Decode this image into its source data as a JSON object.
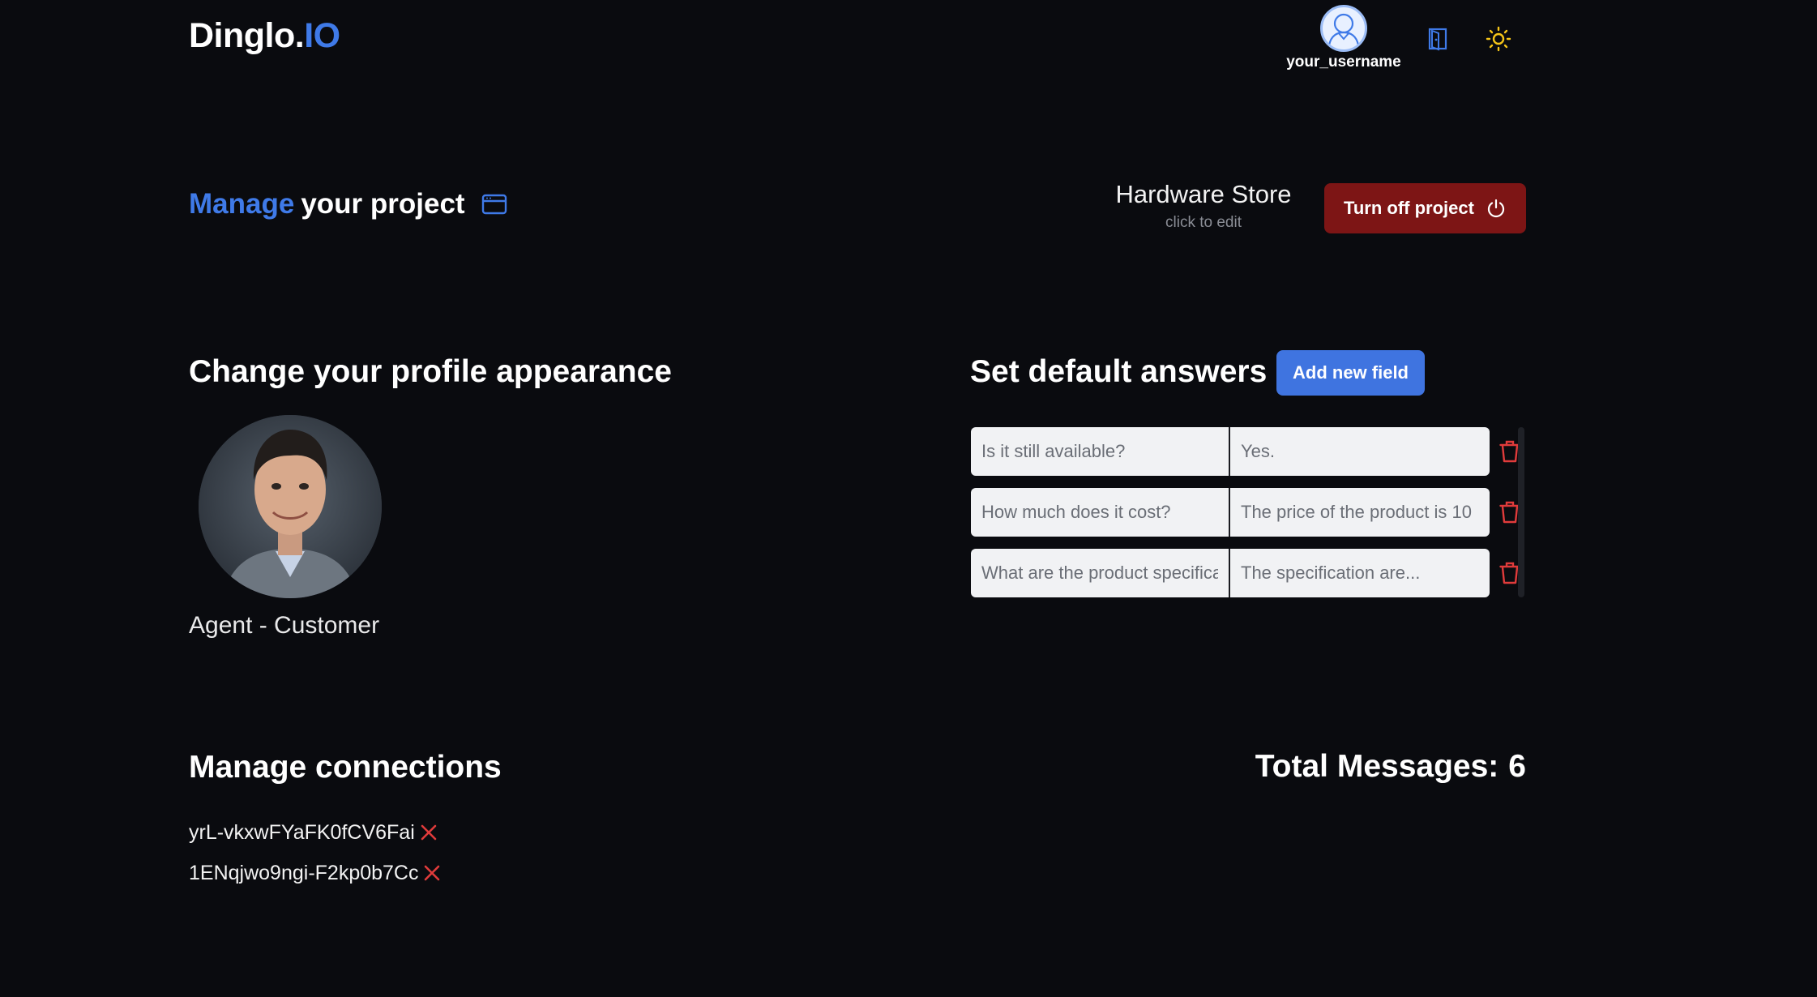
{
  "header": {
    "logo_main": "Dinglo.",
    "logo_accent": "IO",
    "username": "your_username"
  },
  "project": {
    "title_accent": "Manage",
    "title_rest": "your project",
    "name": "Hardware Store",
    "edit_hint": "click to edit",
    "turn_off_label": "Turn off project"
  },
  "profile": {
    "heading": "Change your profile appearance",
    "agent_label": "Agent - Customer"
  },
  "answers": {
    "heading": "Set default answers",
    "add_label": "Add new field",
    "rows": [
      {
        "question_placeholder": "Is it still available?",
        "answer_placeholder": "Yes."
      },
      {
        "question_placeholder": "How much does it cost?",
        "answer_placeholder": "The price of the product is 10"
      },
      {
        "question_placeholder": "What are the product specifications?",
        "answer_placeholder": "The specification are..."
      }
    ]
  },
  "connections": {
    "heading": "Manage connections",
    "items": [
      {
        "id": "yrL-vkxwFYaFK0fCV6Fai"
      },
      {
        "id": "1ENqjwo9ngi-F2kp0b7Cc"
      }
    ]
  },
  "stats": {
    "total_label": "Total Messages:",
    "total_value": "6"
  },
  "colors": {
    "background": "#0a0b0f",
    "accent_blue": "#3f7ae8",
    "danger_dark_red": "#7d1515",
    "delete_red": "#e03b3b",
    "sun_yellow": "#f5c518"
  },
  "icons": [
    "user-avatar-icon",
    "exit-door-icon",
    "sun-icon",
    "window-icon",
    "power-icon",
    "trash-icon",
    "close-x-icon"
  ]
}
